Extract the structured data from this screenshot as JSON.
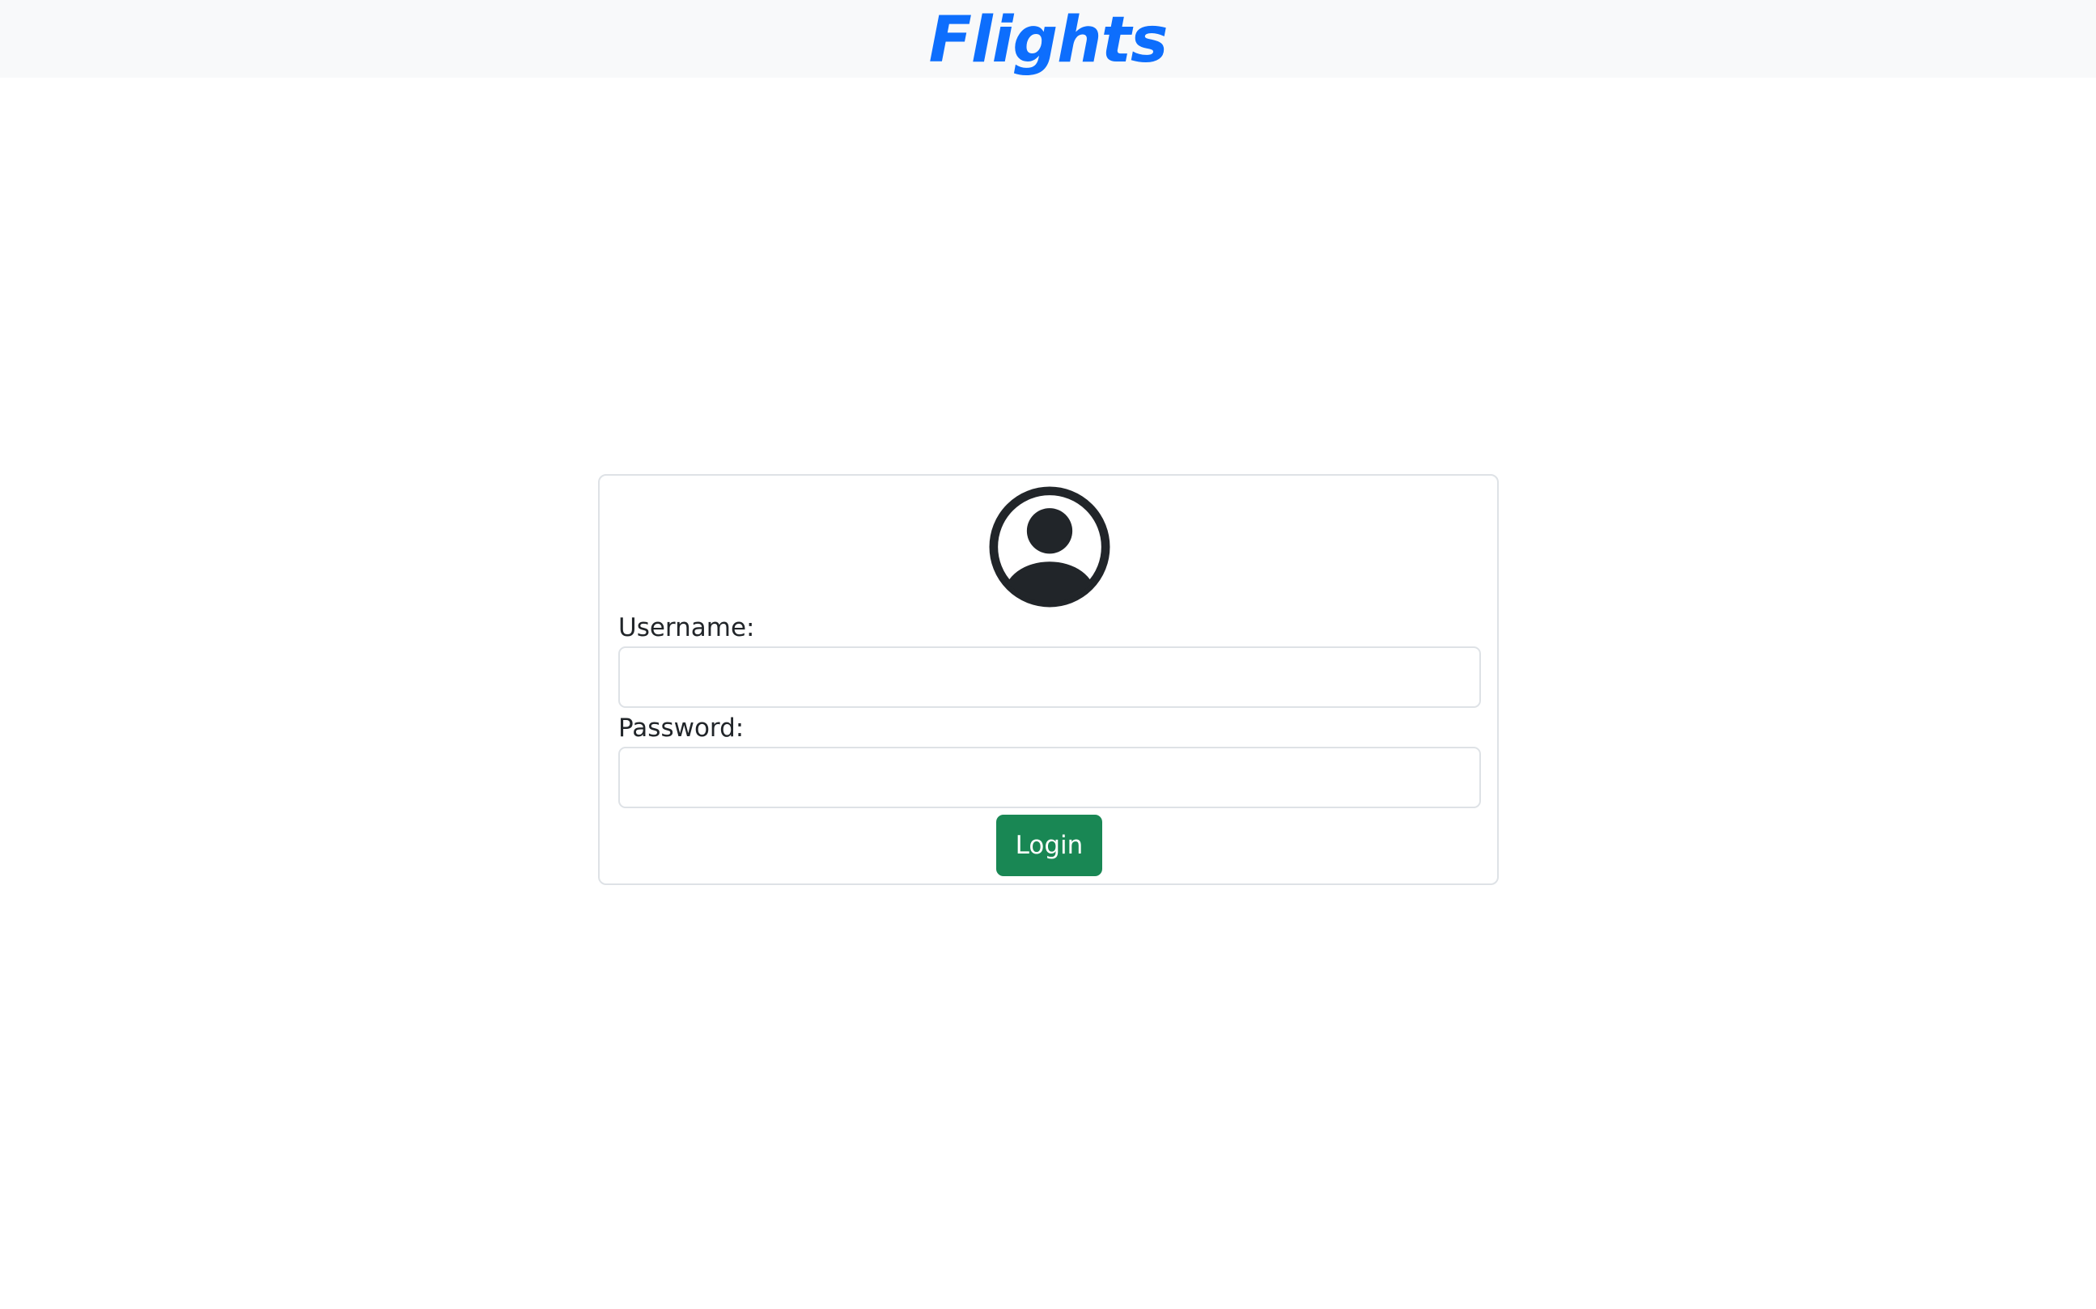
{
  "header": {
    "brand": "Flights",
    "brand_color": "#0d6efd"
  },
  "login_card": {
    "avatar_icon": "person-circle-icon",
    "username_label": "Username:",
    "username_value": "",
    "password_label": "Password:",
    "password_value": "",
    "login_button": "Login",
    "login_button_color": "#198754"
  }
}
